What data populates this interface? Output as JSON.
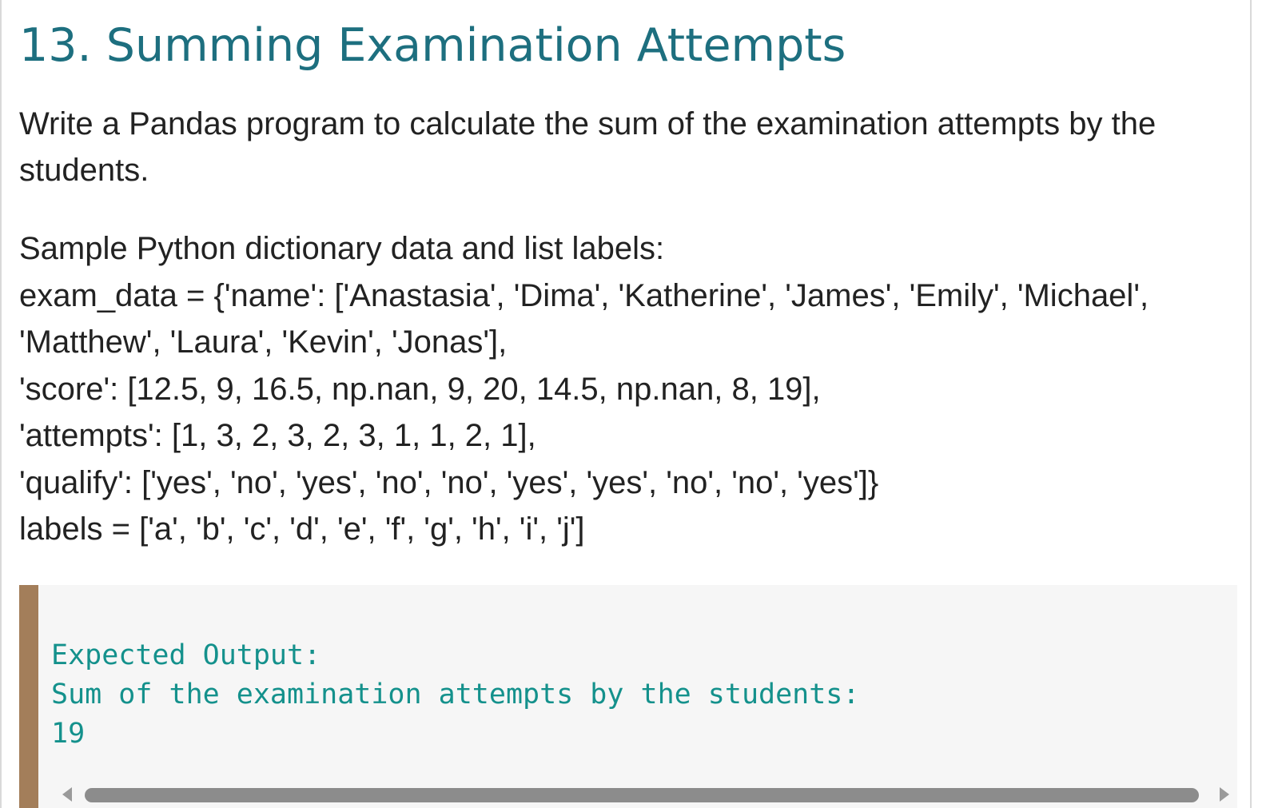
{
  "exercise": {
    "title": "13. Summing Examination Attempts",
    "description": "Write a Pandas program to calculate the sum of the examination attempts by the students."
  },
  "sample": {
    "heading": "Sample Python dictionary data and list labels:",
    "lines": [
      "exam_data = {'name': ['Anastasia', 'Dima', 'Katherine', 'James', 'Emily', 'Michael',",
      "'Matthew', 'Laura', 'Kevin', 'Jonas'],",
      "'score': [12.5, 9, 16.5, np.nan, 9, 20, 14.5, np.nan, 8, 19],",
      "'attempts': [1, 3, 2, 3, 2, 3, 1, 1, 2, 1],",
      "'qualify': ['yes', 'no', 'yes', 'no', 'no', 'yes', 'yes', 'no', 'no', 'yes']}",
      "labels = ['a', 'b', 'c', 'd', 'e', 'f', 'g', 'h', 'i', 'j']"
    ]
  },
  "expected_output": {
    "heading": "Expected Output:",
    "caption": "Sum of the examination attempts by the students:",
    "value": "19"
  },
  "icons": {
    "scroll_left": "chevron-left-icon",
    "scroll_right": "chevron-right-icon"
  },
  "colors": {
    "title": "#1d6f7f",
    "code_text": "#14918c",
    "code_border": "#a37e5a",
    "code_background": "#f6f6f6"
  }
}
